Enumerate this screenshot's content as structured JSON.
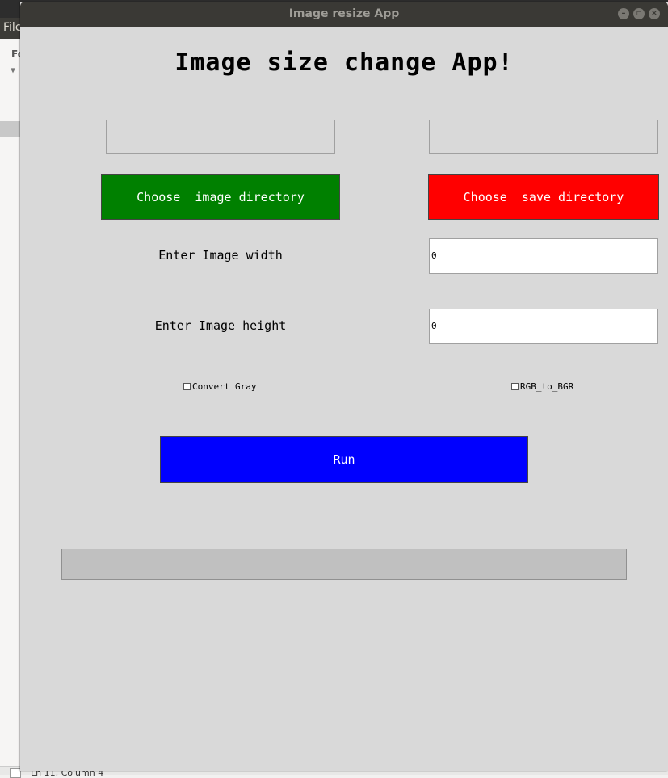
{
  "background_app": {
    "menu_file": "File",
    "panel_label": "Fo",
    "status_text": "Ln 11, Column 4"
  },
  "window": {
    "title": "Image resize App",
    "controls": {
      "minimize_icon": "minimize-icon",
      "maximize_icon": "maximize-icon",
      "close_icon": "close-icon"
    }
  },
  "app": {
    "heading": "Image size change App!",
    "image_dir_value": "",
    "save_dir_value": "",
    "choose_image_label": "Choose  image directory",
    "choose_save_label": "Choose  save directory",
    "width_label": "Enter Image width",
    "width_value": "0",
    "height_label": "Enter Image height",
    "height_value": "0",
    "convert_gray_label": "Convert Gray",
    "convert_gray_checked": false,
    "rgb_to_bgr_label": "RGB_to_BGR",
    "rgb_to_bgr_checked": false,
    "run_label": "Run",
    "progress_fraction": 0
  },
  "colors": {
    "choose_image_bg": "#008000",
    "choose_save_bg": "#ff0000",
    "run_bg": "#0000ff",
    "window_bg": "#d9d9d9"
  }
}
